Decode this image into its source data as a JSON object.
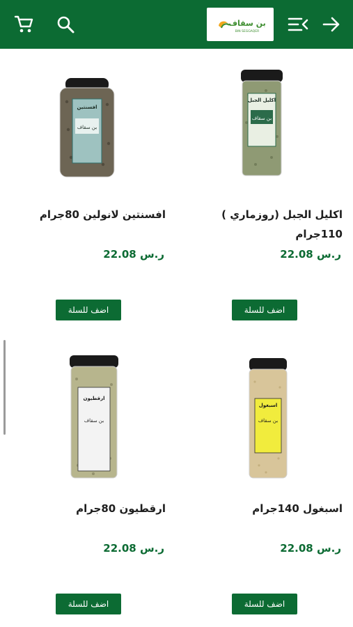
{
  "header": {
    "back_icon": "arrow-right-icon",
    "menu_icon": "menu-collapse-icon",
    "logo_text": "بن سقاف",
    "logo_sub": "BIN SEGGAQER",
    "search_icon": "search-icon",
    "cart_icon": "cart-icon"
  },
  "colors": {
    "brand_green": "#0c6b33",
    "price_green": "#0c6b33",
    "title_text": "#1e1e1e"
  },
  "products": [
    {
      "title": "اكليل الجبل (روزماري ) 110جرام",
      "price": "22.08 ر.س",
      "button": "اضف للسلة",
      "jar_label": "اكليل الجبل",
      "jar_brand": "بن سقاف"
    },
    {
      "title": "افسنتين لانولين 80جرام",
      "price": "22.08 ر.س",
      "button": "اضف للسلة",
      "jar_label": "افسنتين",
      "jar_brand": "بن سقاف"
    },
    {
      "title": "اسبغول 140جرام",
      "price": "22.08 ر.س",
      "button": "اضف للسلة",
      "jar_label": "اسبغول",
      "jar_brand": "بن سقاف"
    },
    {
      "title": "ارقطيون 80جرام",
      "price": "22.08 ر.س",
      "button": "اضف للسلة",
      "jar_label": "ارقطيون",
      "jar_brand": "بن سقاف"
    }
  ]
}
